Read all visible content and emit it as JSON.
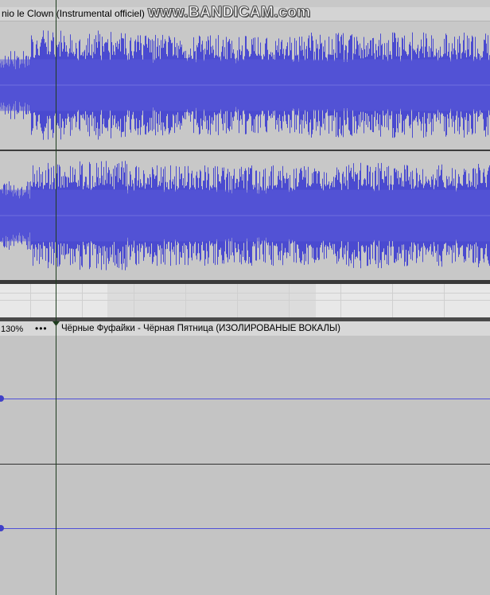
{
  "track1": {
    "clip_title": "nio le Clown (Instrumental officiel)"
  },
  "watermark": {
    "text": "www.BANDICAM.com"
  },
  "track2": {
    "zoom": "130%",
    "menu": "•••",
    "clip_title": "Чёрные Фуфайки - Чёрная Пятница (ИЗОЛИРОВАНЫЕ ВОКАЛЫ)"
  },
  "colors": {
    "waveform": "#4a4ad0",
    "background": "#c8c8c8",
    "cursor": "#1e3c1e"
  }
}
